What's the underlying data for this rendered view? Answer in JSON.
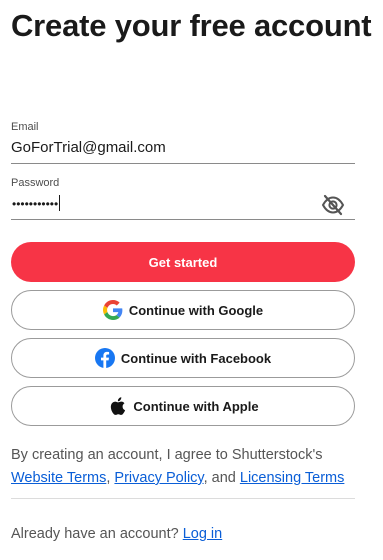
{
  "header": {
    "title": "Create your free account"
  },
  "form": {
    "email": {
      "label": "Email",
      "value": "GoForTrial@gmail.com"
    },
    "password": {
      "label": "Password",
      "masked_value": "•••••••••••",
      "visibility_icon": "eye-slash-icon"
    }
  },
  "buttons": {
    "primary_label": "Get started",
    "google_label": "Continue with Google",
    "facebook_label": "Continue with Facebook",
    "apple_label": "Continue with Apple"
  },
  "legal": {
    "prefix": "By creating an account, I agree to Shutterstock's",
    "website_terms": "Website Terms",
    "sep1": ",",
    "privacy_policy": "Privacy Policy",
    "sep2": ", and",
    "licensing_terms": "Licensing Terms"
  },
  "login": {
    "prompt": "Already have an account?",
    "link": "Log in"
  },
  "colors": {
    "primary": "#f73446",
    "link": "#0a5ed7",
    "facebook": "#1877f2"
  }
}
